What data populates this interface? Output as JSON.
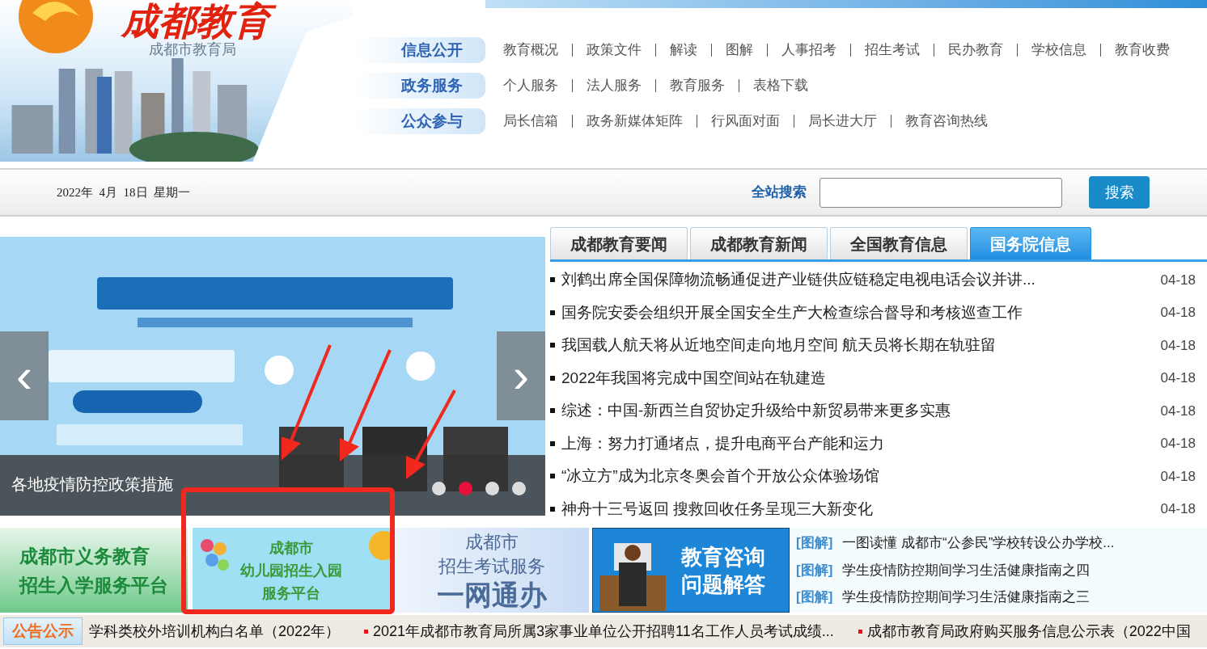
{
  "header": {
    "logo_title": "成都教育",
    "logo_subtitle": "成都市教育局",
    "nav": [
      {
        "label": "信息公开",
        "links": [
          "教育概况",
          "政策文件",
          "解读",
          "图解",
          "人事招考",
          "招生考试",
          "民办教育",
          "学校信息",
          "教育收费"
        ]
      },
      {
        "label": "政务服务",
        "links": [
          "个人服务",
          "法人服务",
          "教育服务",
          "表格下载"
        ]
      },
      {
        "label": "公众参与",
        "links": [
          "局长信箱",
          "政务新媒体矩阵",
          "行风面对面",
          "局长进大厅",
          "教育咨询热线"
        ]
      }
    ]
  },
  "toolbar": {
    "date": "2022年  4月  18日  星期一",
    "search_label": "全站搜索",
    "search_button": "搜索"
  },
  "slider": {
    "prev": "‹",
    "next": "›",
    "caption": "各地疫情防控政策措施",
    "dots": [
      {
        "selected": false
      },
      {
        "selected": true
      },
      {
        "selected": false
      },
      {
        "selected": false
      }
    ]
  },
  "news": {
    "tabs": [
      {
        "label": "成都教育要闻",
        "selected": false
      },
      {
        "label": "成都教育新闻",
        "selected": false
      },
      {
        "label": "全国教育信息",
        "selected": false
      },
      {
        "label": "国务院信息",
        "selected": true
      }
    ],
    "items": [
      {
        "title": "刘鹤出席全国保障物流畅通促进产业链供应链稳定电视电话会议并讲...",
        "date": "04-18"
      },
      {
        "title": "国务院安委会组织开展全国安全生产大检查综合督导和考核巡查工作",
        "date": "04-18"
      },
      {
        "title": "我国载人航天将从近地空间走向地月空间 航天员将长期在轨驻留",
        "date": "04-18"
      },
      {
        "title": "2022年我国将完成中国空间站在轨建造",
        "date": "04-18"
      },
      {
        "title": "综述：中国-新西兰自贸协定升级给中新贸易带来更多实惠",
        "date": "04-18"
      },
      {
        "title": "上海：努力打通堵点，提升电商平台产能和运力",
        "date": "04-18"
      },
      {
        "title": "“冰立方”成为北京冬奥会首个开放公众体验场馆",
        "date": "04-18"
      },
      {
        "title": "神舟十三号返回 搜救回收任务呈现三大新变化",
        "date": "04-18"
      }
    ]
  },
  "banners": [
    {
      "kind": "green",
      "lines": [
        "成都市义务教育",
        "招生入学服务平台"
      ]
    },
    {
      "kind": "kids",
      "lines": [
        "成都市",
        "幼儿园招生入园",
        "服务平台"
      ]
    },
    {
      "kind": "exam",
      "lines": [
        "成都市",
        "招生考试服务",
        "一网通办"
      ]
    },
    {
      "kind": "consult",
      "lines": [
        "教育咨询",
        "问题解答"
      ]
    }
  ],
  "graphics": [
    {
      "tag": "[图解]",
      "title": "一图读懂 成都市“公参民”学校转设公办学校..."
    },
    {
      "tag": "[图解]",
      "title": "学生疫情防控期间学习生活健康指南之四"
    },
    {
      "tag": "[图解]",
      "title": "学生疫情防控期间学习生活健康指南之三"
    }
  ],
  "notices": {
    "label": "公告公示",
    "items": [
      "学科类校外培训机构白名单（2022年）",
      "2021年成都市教育局所属3家事业单位公开招聘11名工作人员考试成绩...",
      "成都市教育局政府购买服务信息公示表（2022中国"
    ]
  }
}
